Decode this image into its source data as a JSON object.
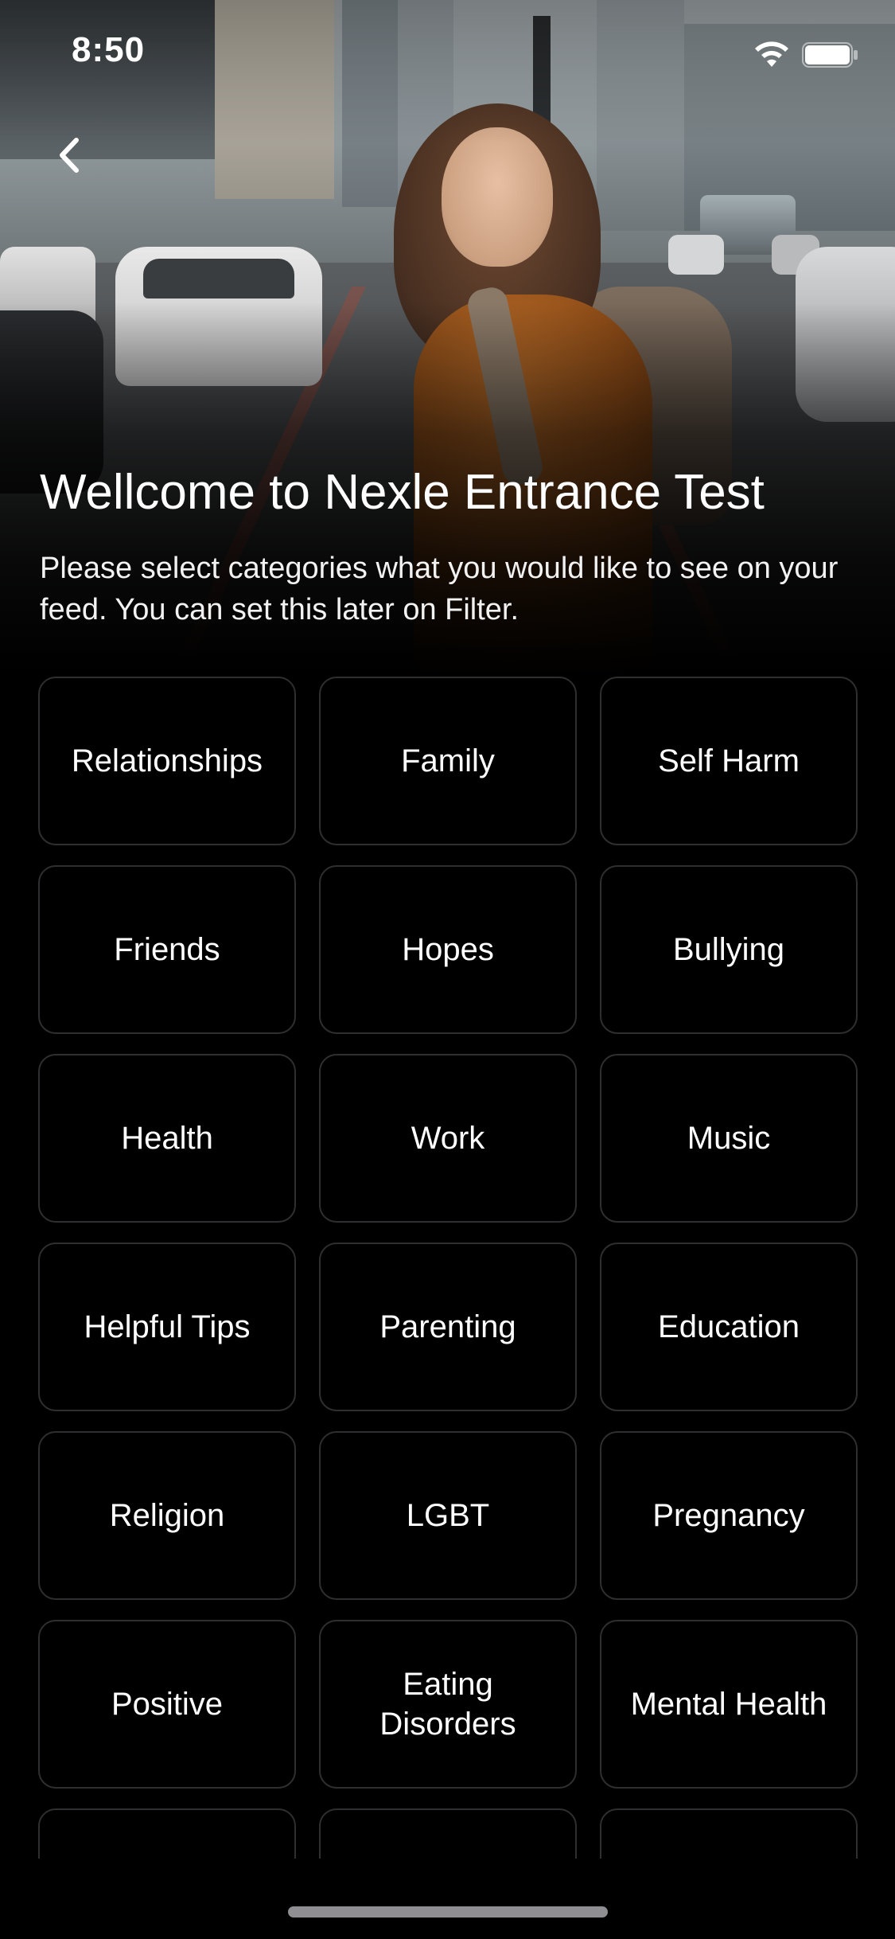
{
  "status_bar": {
    "time": "8:50",
    "wifi_icon": "wifi-icon",
    "battery_icon": "battery-full-icon"
  },
  "nav": {
    "back_icon": "chevron-left-icon"
  },
  "header": {
    "title": "Wellcome to Nexle Entrance Test",
    "subtitle": "Please select categories what you would like to see on your feed. You can set this later on Filter."
  },
  "hero": {
    "description_icon": "hero-photo"
  },
  "categories": [
    {
      "label": "Relationships"
    },
    {
      "label": "Family"
    },
    {
      "label": "Self Harm"
    },
    {
      "label": "Friends"
    },
    {
      "label": "Hopes"
    },
    {
      "label": "Bullying"
    },
    {
      "label": "Health"
    },
    {
      "label": "Work"
    },
    {
      "label": "Music"
    },
    {
      "label": "Helpful Tips"
    },
    {
      "label": "Parenting"
    },
    {
      "label": "Education"
    },
    {
      "label": "Religion"
    },
    {
      "label": "LGBT"
    },
    {
      "label": "Pregnancy"
    },
    {
      "label": "Positive"
    },
    {
      "label": "Eating Disorders"
    },
    {
      "label": "Mental Health"
    },
    {
      "label": ""
    },
    {
      "label": ""
    },
    {
      "label": ""
    }
  ],
  "colors": {
    "background": "#000000",
    "card_border": "#2f2f31",
    "text": "#ffffff",
    "home_indicator": "#8e8e93"
  }
}
